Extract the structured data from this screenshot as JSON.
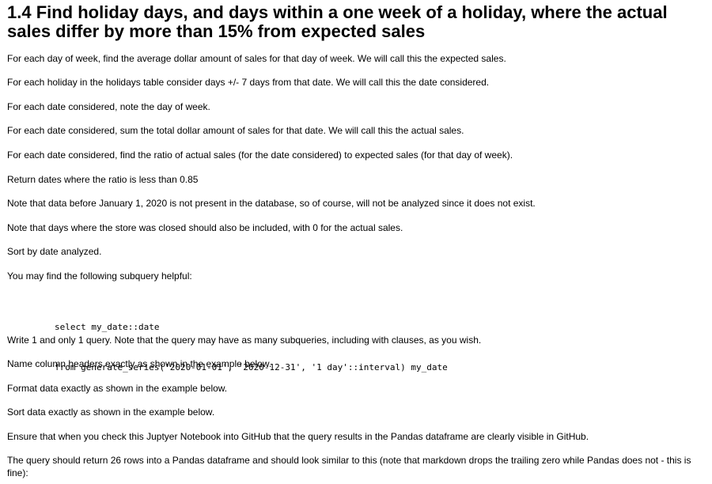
{
  "heading": "1.4 Find holiday days, and days within a one week of a holiday, where the actual sales differ by more than 15% from expected sales",
  "paragraphs": [
    "For each day of week, find the average dollar amount of sales for that day of week. We will call this the expected sales.",
    "For each holiday in the holidays table consider days +/- 7 days from that date. We will call this the date considered.",
    "For each date considered, note the day of week.",
    "For each date considered, sum the total dollar amount of sales for that date. We will call this the actual sales.",
    "For each date considered, find the ratio of actual sales (for the date considered) to expected sales (for that day of week).",
    "Return dates where the ratio is less than 0.85",
    "Note that data before January 1, 2020 is not present in the database, so of course, will not be analyzed since it does not exist.",
    "Note that days where the store was closed should also be included, with 0 for the actual sales.",
    "Sort by date analyzed.",
    "You may find the following subquery helpful:",
    "Write 1 and only 1 query. Note that the query may have as many subqueries, including with clauses, as you wish.",
    "Name column headers exactly as shown in the example below.",
    "Format data exactly as shown in the example below.",
    "Sort data exactly as shown in the example below.",
    "Ensure that when you check this Juptyer Notebook into GitHub that the query results in the Pandas dataframe are clearly visible in GitHub.",
    "The query should return 26 rows into a Pandas dataframe and should look similar to this (note that markdown drops the trailing zero while Pandas does not - this is fine):"
  ],
  "code": {
    "line1": "select my_date::date",
    "line2": "from generate_series('2020-01-01', '2020-12-31', '1 day'::interval) my_date"
  }
}
